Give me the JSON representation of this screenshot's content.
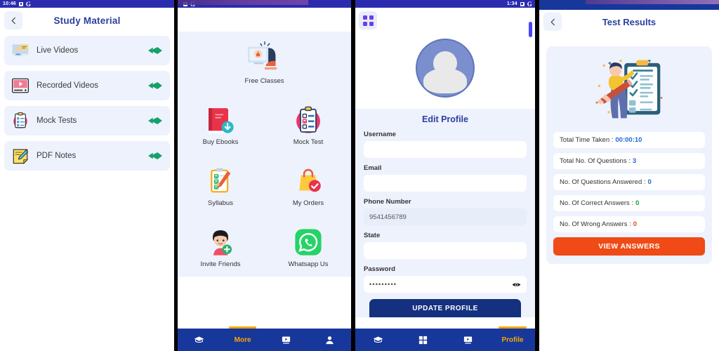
{
  "study_material": {
    "statusbar": {
      "time": "10:46",
      "google_label": "G"
    },
    "title": "Study Material",
    "back_icon": "chevron-left-icon",
    "items": [
      {
        "label": "Live Videos",
        "icon": "live-video-icon"
      },
      {
        "label": "Recorded Videos",
        "icon": "recorded-video-icon"
      },
      {
        "label": "Mock Tests",
        "icon": "clipboard-checklist-icon"
      },
      {
        "label": "PDF Notes",
        "icon": "notes-pencil-icon"
      }
    ]
  },
  "grid_menu": {
    "statusbar": {
      "time": "",
      "google_label": "G"
    },
    "tiles": [
      {
        "label": "Free Classes",
        "icon": "free-classes-icon"
      },
      {
        "label": "Buy Ebooks",
        "icon": "ebook-download-icon"
      },
      {
        "label": "Mock Test",
        "icon": "mock-test-icon"
      },
      {
        "label": "Syllabus",
        "icon": "syllabus-icon"
      },
      {
        "label": "My Orders",
        "icon": "shopping-bag-icon"
      },
      {
        "label": "Invite Friends",
        "icon": "invite-friend-icon"
      },
      {
        "label": "Whatsapp Us",
        "icon": "whatsapp-icon"
      }
    ],
    "bottom_nav": [
      {
        "label": "",
        "icon": "graduation-cap-icon",
        "active": false
      },
      {
        "label": "More",
        "icon": "grid-icon",
        "active": true
      },
      {
        "label": "",
        "icon": "video-icon",
        "active": false
      },
      {
        "label": "",
        "icon": "person-icon",
        "active": false
      }
    ]
  },
  "edit_profile": {
    "statusbar": {
      "time": "1:34",
      "google_label": "G"
    },
    "grid_button_icon": "four-dots-grid-icon",
    "title": "Edit Profile",
    "fields": [
      {
        "label": "Username",
        "value": "",
        "filled": false
      },
      {
        "label": "Email",
        "value": "",
        "filled": false
      },
      {
        "label": "Phone Number",
        "value": "9541456789",
        "filled": true
      },
      {
        "label": "State",
        "value": "",
        "filled": false
      }
    ],
    "password": {
      "label": "Password",
      "masked_value": "•••••••••",
      "toggle_icon": "eye-icon"
    },
    "update_button": "UPDATE PROFILE",
    "bottom_nav": [
      {
        "label": "",
        "icon": "graduation-cap-icon",
        "active": false
      },
      {
        "label": "",
        "icon": "grid-icon",
        "active": false
      },
      {
        "label": "",
        "icon": "video-icon",
        "active": false
      },
      {
        "label": "Profile",
        "icon": "person-icon",
        "active": true
      }
    ]
  },
  "test_results": {
    "title": "Test Results",
    "back_icon": "chevron-left-icon",
    "illustration": "person-with-checklist-illustration",
    "rows": [
      {
        "label": "Total Time Taken : ",
        "value": "00:00:10",
        "color": "#2268d8"
      },
      {
        "label": "Total No. Of Questions : ",
        "value": "3",
        "color": "#2268d8"
      },
      {
        "label": "No. Of Questions Answered : ",
        "value": "0",
        "color": "#2268d8"
      },
      {
        "label": "No. Of Correct Answers : ",
        "value": "0",
        "color": "#1da13a"
      },
      {
        "label": "No. Of Wrong Answers : ",
        "value": "0",
        "color": "#e8481a"
      }
    ],
    "view_answers_button": "VIEW ANSWERS"
  },
  "colors": {
    "brand_blue": "#17379b",
    "title_blue": "#2b3fa0",
    "panel_bg": "#eef2fd",
    "accent_orange": "#f5a800",
    "cta_orange": "#f04a16",
    "status_purple": "#2b2bb0"
  }
}
